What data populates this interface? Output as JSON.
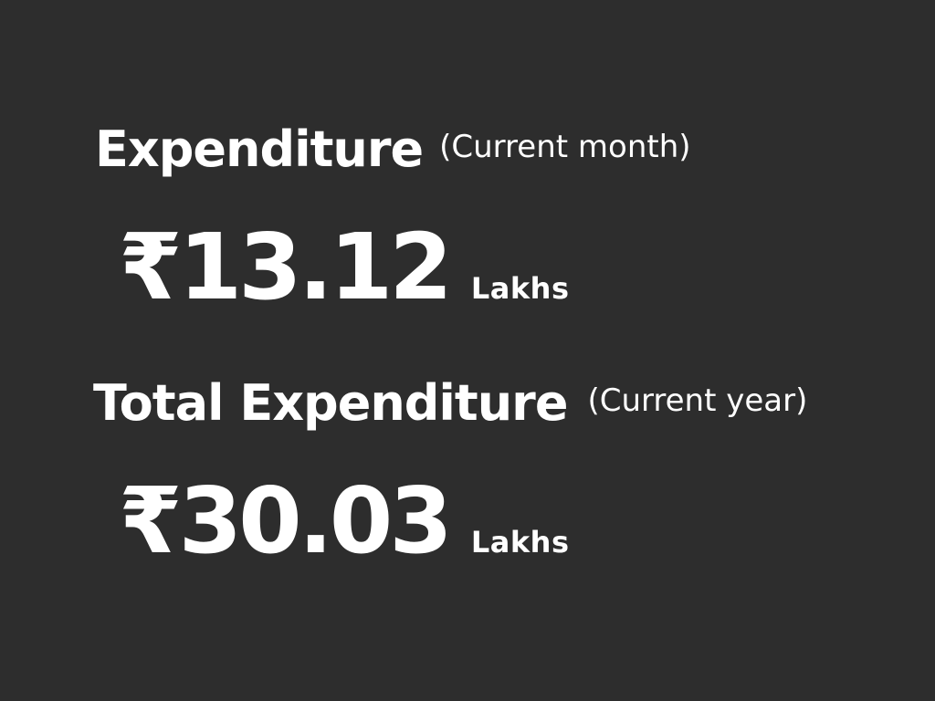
{
  "monthly": {
    "title": "Expenditure",
    "period": "(Current month)",
    "amount": "₹13.12",
    "unit": "Lakhs"
  },
  "yearly": {
    "title": "Total Expenditure",
    "period": "(Current year)",
    "amount": "₹30.03",
    "unit": "Lakhs"
  },
  "colors": {
    "background": "#2d2d2d",
    "text": "#ffffff"
  }
}
